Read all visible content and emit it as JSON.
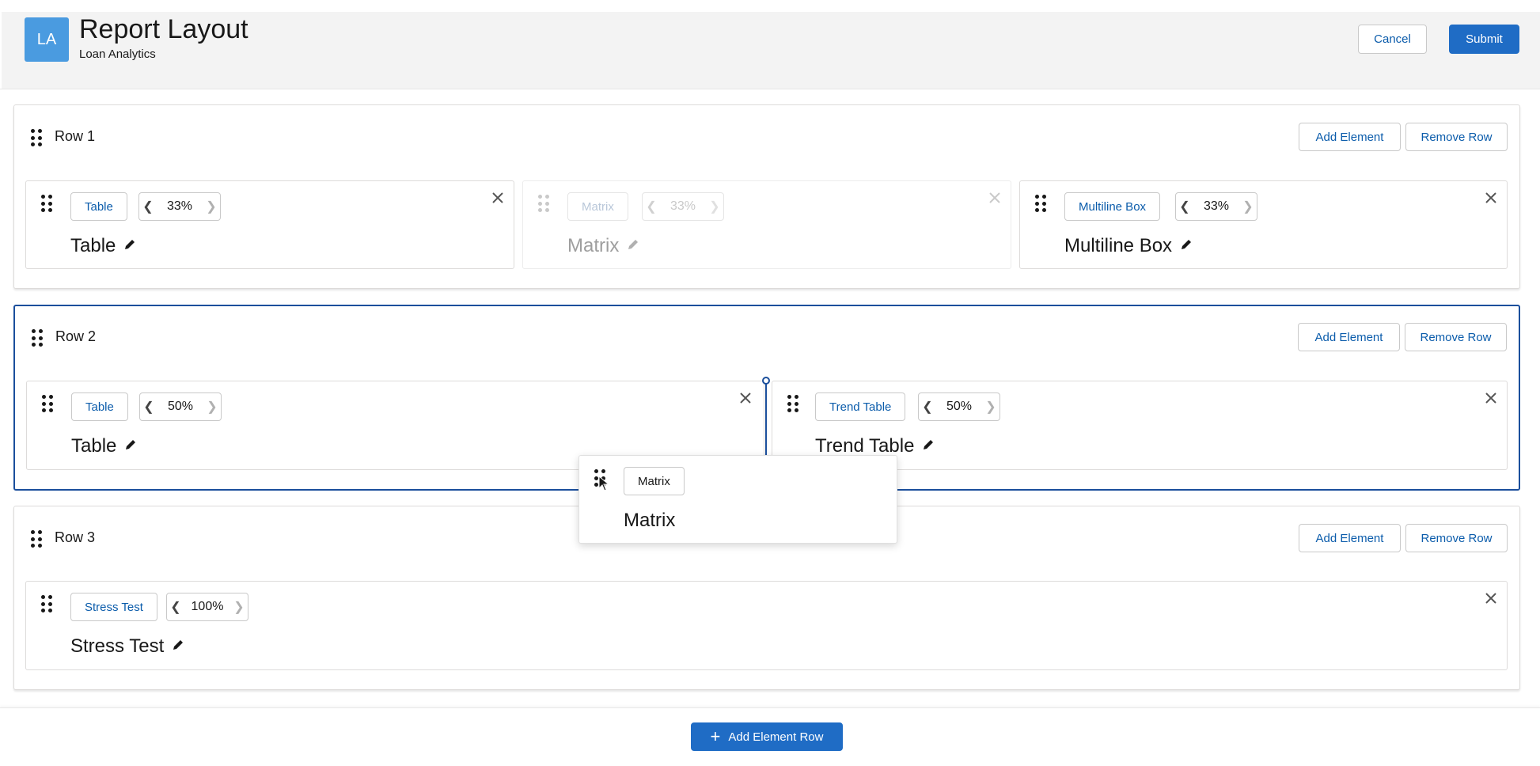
{
  "app": {
    "icon_initials": "LA",
    "title": "Report Layout",
    "subtitle": "Loan Analytics"
  },
  "header_actions": {
    "cancel_label": "Cancel",
    "submit_label": "Submit"
  },
  "row_actions": {
    "add_element_label": "Add Element",
    "remove_row_label": "Remove Row"
  },
  "rows": [
    {
      "label": "Row 1",
      "elements": [
        {
          "type": "Table",
          "width": "33%",
          "title": "Table"
        },
        {
          "type": "Matrix",
          "width": "33%",
          "title": "Matrix"
        },
        {
          "type": "Multiline Box",
          "width": "33%",
          "title": "Multiline Box"
        }
      ]
    },
    {
      "label": "Row 2",
      "elements": [
        {
          "type": "Table",
          "width": "50%",
          "title": "Table"
        },
        {
          "type": "Trend Table",
          "width": "50%",
          "title": "Trend Table"
        }
      ]
    },
    {
      "label": "Row 3",
      "elements": [
        {
          "type": "Stress Test",
          "width": "100%",
          "title": "Stress Test"
        }
      ]
    }
  ],
  "dragging_element": {
    "type": "Matrix",
    "title": "Matrix"
  },
  "footer": {
    "add_row_label": "Add Element Row"
  },
  "colors": {
    "brand": "#1f6cc5",
    "link": "#0b5cab",
    "active_row_border": "#1b4f9c",
    "app_icon": "#4a9be0"
  },
  "icons": {
    "drag_handle": "grip-dots-icon",
    "close": "close-icon",
    "edit": "pencil-icon",
    "width_decrease": "chevron-left-icon",
    "width_increase": "chevron-right-icon",
    "add": "plus-icon",
    "pointer": "cursor-icon"
  }
}
